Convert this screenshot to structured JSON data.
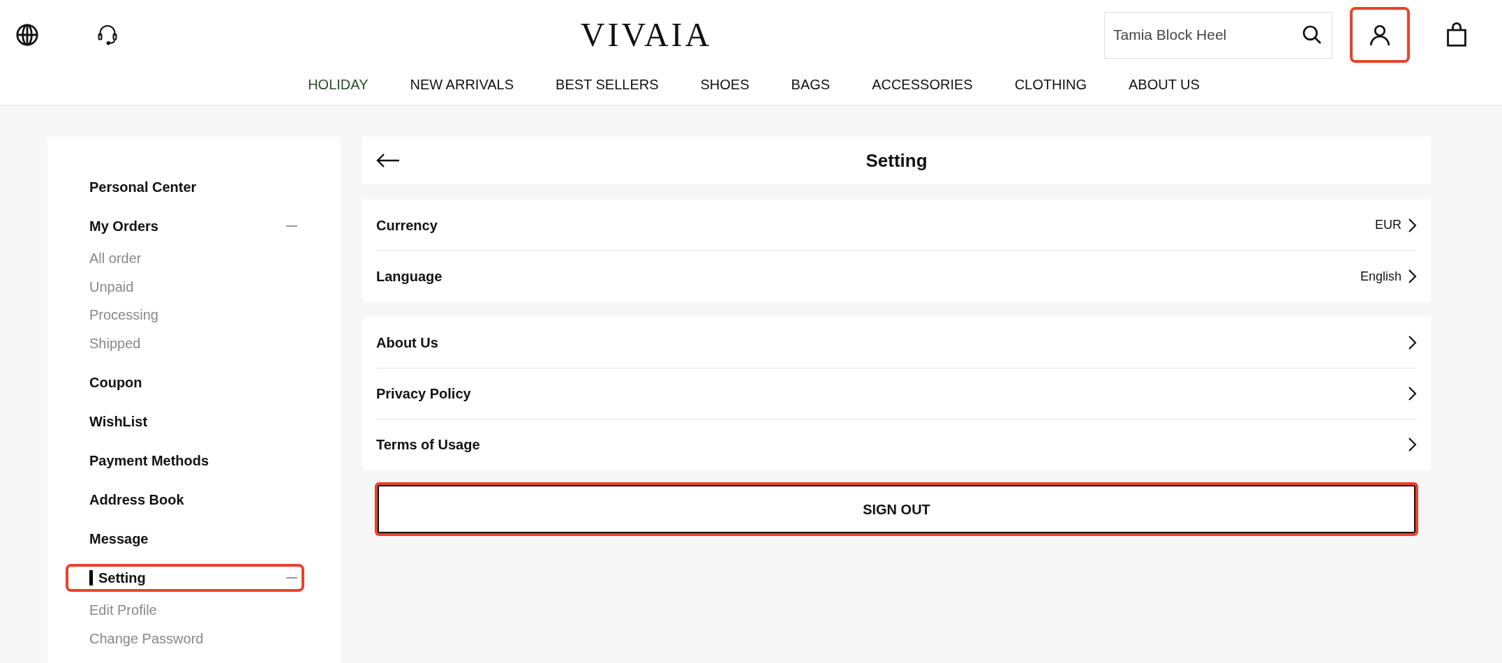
{
  "header": {
    "logo": "VIVAIA",
    "search": {
      "value": "Tamia Block Heel"
    },
    "account_highlighted": true
  },
  "nav": [
    {
      "label": "HOLIDAY",
      "selected": true
    },
    {
      "label": "NEW ARRIVALS",
      "selected": false
    },
    {
      "label": "BEST SELLERS",
      "selected": false
    },
    {
      "label": "SHOES",
      "selected": false
    },
    {
      "label": "BAGS",
      "selected": false
    },
    {
      "label": "ACCESSORIES",
      "selected": false
    },
    {
      "label": "CLOTHING",
      "selected": false
    },
    {
      "label": "ABOUT US",
      "selected": false
    }
  ],
  "sidebar": {
    "items": [
      {
        "label": "Personal Center",
        "selected": false,
        "highlighted": false
      },
      {
        "label": "My Orders",
        "selected": false,
        "highlighted": false,
        "expanded": true,
        "children": [
          {
            "label": "All order"
          },
          {
            "label": "Unpaid"
          },
          {
            "label": "Processing"
          },
          {
            "label": "Shipped"
          }
        ]
      },
      {
        "label": "Coupon",
        "selected": false,
        "highlighted": false
      },
      {
        "label": "WishList",
        "selected": false,
        "highlighted": false
      },
      {
        "label": "Payment Methods",
        "selected": false,
        "highlighted": false
      },
      {
        "label": "Address Book",
        "selected": false,
        "highlighted": false
      },
      {
        "label": "Message",
        "selected": false,
        "highlighted": false
      },
      {
        "label": "Setting",
        "selected": true,
        "highlighted": true,
        "expanded": true,
        "children": [
          {
            "label": "Edit Profile"
          },
          {
            "label": "Change Password"
          }
        ]
      }
    ]
  },
  "page_title": "Setting",
  "groups": [
    [
      {
        "label": "Currency",
        "value": "EUR"
      },
      {
        "label": "Language",
        "value": "English"
      }
    ],
    [
      {
        "label": "About Us"
      },
      {
        "label": "Privacy Policy"
      },
      {
        "label": "Terms of Usage"
      }
    ]
  ],
  "sign_out": {
    "label": "SIGN OUT",
    "highlighted": true
  }
}
